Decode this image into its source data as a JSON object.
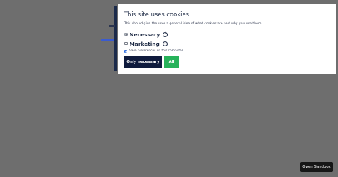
{
  "cookie_dialog": {
    "title": "This site uses cookies",
    "description": "This should give the user a general idea of what cookies are and why you use them.",
    "options": [
      {
        "label": "Necessary",
        "checked": true,
        "disabled": true,
        "info_icon": "info-icon"
      },
      {
        "label": "Marketing",
        "checked": false,
        "disabled": false,
        "info_icon": "info-icon"
      }
    ],
    "save_preferences": {
      "label": "Save preferences on this computer",
      "checked": true
    },
    "buttons": {
      "only_necessary": "Only necessary",
      "all": "All"
    }
  },
  "sandbox": {
    "label": "Open Sandbox"
  },
  "colors": {
    "overlay": "#6e6e6e",
    "dialog_bg": "#ffffff",
    "primary_dark": "#0f1b3d",
    "accent_green": "#27b25a",
    "checkbox_blue": "#2f6fe0"
  }
}
